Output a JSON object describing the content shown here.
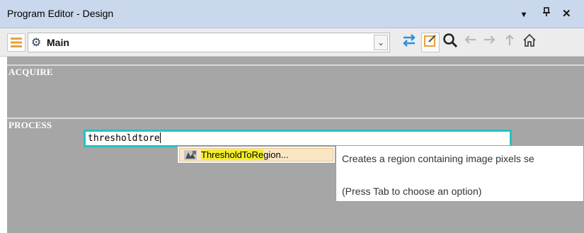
{
  "window": {
    "title": "Program Editor - Design",
    "controls": [
      "▾",
      "ᵽ",
      "✕"
    ]
  },
  "toolbar": {
    "procedure_label": "Main",
    "icons": [
      "menu-icon",
      "procedure-icon",
      "dropdown-icon",
      "swap-icon",
      "edit-icon",
      "search-icon",
      "back-icon",
      "forward-icon",
      "up-icon",
      "home-icon"
    ],
    "accent": "#e8a23a"
  },
  "editor": {
    "sections": [
      {
        "label": "ACQUIRE"
      },
      {
        "label": "PROCESS"
      }
    ],
    "input_value": "thresholdtore",
    "input_border_color": "#27c1c1",
    "background_color": "#a6a6a6"
  },
  "autocomplete": {
    "item_match": "ThresholdToRe",
    "item_rest": "gion...",
    "highlight_color": "#f3ee28"
  },
  "tooltip": {
    "line1": "Creates a region containing image pixels se",
    "line2": "(Press Tab to choose an option)"
  }
}
